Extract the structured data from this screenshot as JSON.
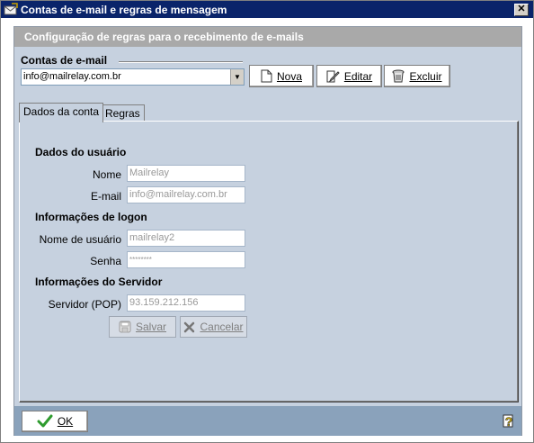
{
  "window": {
    "title": "Contas de e-mail e regras de mensagem",
    "close_label": "✕"
  },
  "header": {
    "title": "Configuração de regras para o recebimento de e-mails"
  },
  "accounts": {
    "label": "Contas de e-mail",
    "selected": "info@mailrelay.com.br",
    "buttons": {
      "new": "Nova",
      "edit": "Editar",
      "delete": "Excluir"
    }
  },
  "tabs": [
    {
      "label": "Dados da conta",
      "active": true
    },
    {
      "label": "Regras",
      "active": false
    }
  ],
  "form": {
    "user_group": "Dados do usuário",
    "name_label": "Nome",
    "name_value": "Mailrelay",
    "email_label": "E-mail",
    "email_value": "info@mailrelay.com.br",
    "logon_group": "Informações de logon",
    "username_label": "Nome de usuário",
    "username_value": "mailrelay2",
    "password_label": "Senha",
    "password_value": "********",
    "server_group": "Informações do Servidor",
    "server_label": "Servidor (POP)",
    "server_value": "93.159.212.156",
    "save_label": "Salvar",
    "cancel_label": "Cancelar"
  },
  "footer": {
    "ok_label": "OK"
  },
  "icons": {
    "app": "envelope-app-icon",
    "new": "document-icon",
    "edit": "edit-icon",
    "delete": "trash-icon",
    "save": "disk-icon",
    "cancel": "x-icon",
    "ok": "checkmark-icon",
    "help": "help-icon"
  },
  "colors": {
    "titlebar": "#0a246a",
    "body": "#c6d1df",
    "header": "#a9a9a9",
    "footer": "#8aa2bb",
    "ok_check": "#2e9b2e"
  }
}
